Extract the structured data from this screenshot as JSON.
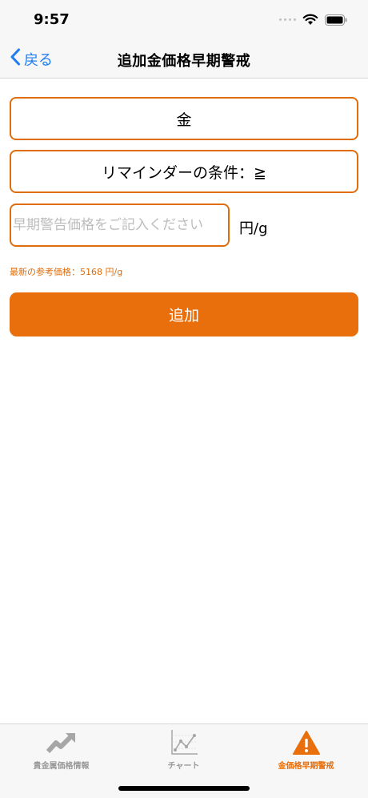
{
  "status_bar": {
    "time": "9:57"
  },
  "nav": {
    "back_label": "戻る",
    "title": "追加金価格早期警戒"
  },
  "form": {
    "metal": "金",
    "condition": "リマインダーの条件：≧",
    "price_input": {
      "value": "",
      "placeholder": "早期警告価格をご記入ください"
    },
    "unit": "円/g",
    "reference": "最新の参考価格：5168 円/g",
    "add_label": "追加"
  },
  "tabs": [
    {
      "label": "貴金属価格情報",
      "icon": "trend-up-icon",
      "active": false
    },
    {
      "label": "チャート",
      "icon": "chart-icon",
      "active": false
    },
    {
      "label": "金価格早期警戒",
      "icon": "warning-icon",
      "active": true
    }
  ],
  "colors": {
    "accent": "#e86f0b",
    "link": "#1f7cf1",
    "inactive_tab": "#9a9a9a"
  }
}
